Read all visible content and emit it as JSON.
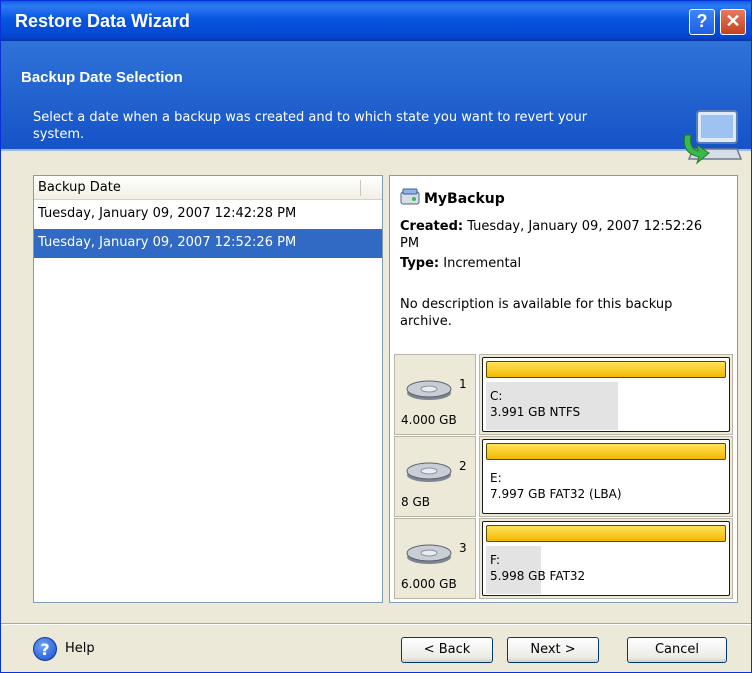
{
  "window": {
    "title": "Restore Data Wizard",
    "help_glyph": "?",
    "close_glyph": "✕"
  },
  "header": {
    "title": "Backup Date Selection",
    "description": "Select a date when a backup was created and to which state you want to revert your system."
  },
  "list": {
    "column_header": "Backup Date",
    "rows": [
      {
        "label": "Tuesday, January 09, 2007 12:42:28 PM",
        "selected": false
      },
      {
        "label": "Tuesday, January 09, 2007 12:52:26 PM",
        "selected": true
      }
    ]
  },
  "info": {
    "name": "MyBackup",
    "created_label": "Created:",
    "created_value": "Tuesday, January 09, 2007 12:52:26 PM",
    "type_label": "Type:",
    "type_value": "Incremental",
    "description": "No description is available for this backup archive."
  },
  "disks": [
    {
      "number": "1",
      "size": "4.000 GB",
      "partition_letter": "C:",
      "partition_info": "3.991 GB  NTFS",
      "used_fraction": 0.55
    },
    {
      "number": "2",
      "size": "8 GB",
      "partition_letter": "E:",
      "partition_info": "7.997 GB  FAT32 (LBA)",
      "used_fraction": 0.0
    },
    {
      "number": "3",
      "size": "6.000 GB",
      "partition_letter": "F:",
      "partition_info": "5.998 GB  FAT32",
      "used_fraction": 0.23
    }
  ],
  "footer": {
    "help_label": "Help",
    "back_label": "< Back",
    "next_label": "Next >",
    "cancel_label": "Cancel"
  }
}
